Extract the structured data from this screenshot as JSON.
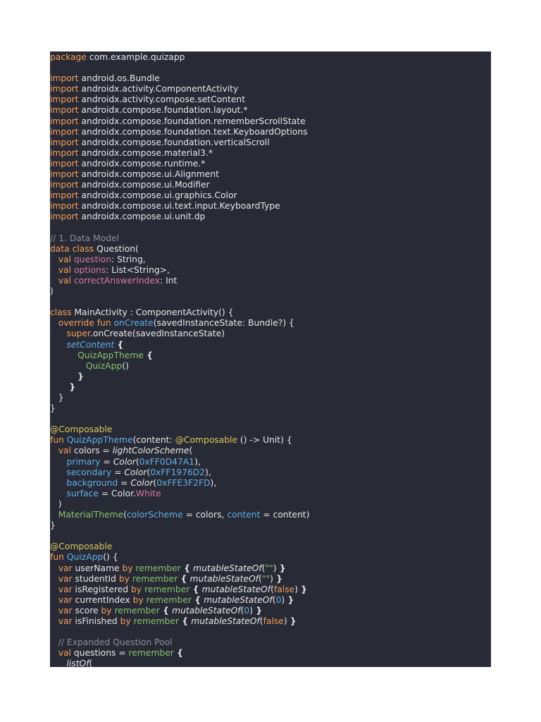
{
  "colors": {
    "page_background": "#ffffff",
    "editor_background": "#282a36",
    "default_text": "#e8e8e8",
    "keyword": "#f5a05a",
    "property": "#d47aa5",
    "function": "#5fb1e8",
    "composable": "#86c46f",
    "annotation": "#d8c95a",
    "comment": "#8b8f9a"
  },
  "code_lines": [
    [
      [
        "keyword",
        "package"
      ],
      [
        "default",
        " com.example.quizapp"
      ]
    ],
    [],
    [
      [
        "keyword",
        "import"
      ],
      [
        "default",
        " android.os.Bundle"
      ]
    ],
    [
      [
        "keyword",
        "import"
      ],
      [
        "default",
        " androidx.activity.ComponentActivity"
      ]
    ],
    [
      [
        "keyword",
        "import"
      ],
      [
        "default",
        " androidx.activity.compose.setContent"
      ]
    ],
    [
      [
        "keyword",
        "import"
      ],
      [
        "default",
        " androidx.compose.foundation.layout.*"
      ]
    ],
    [
      [
        "keyword",
        "import"
      ],
      [
        "default",
        " androidx.compose.foundation.rememberScrollState"
      ]
    ],
    [
      [
        "keyword",
        "import"
      ],
      [
        "default",
        " androidx.compose.foundation.text.KeyboardOptions"
      ]
    ],
    [
      [
        "keyword",
        "import"
      ],
      [
        "default",
        " androidx.compose.foundation.verticalScroll"
      ]
    ],
    [
      [
        "keyword",
        "import"
      ],
      [
        "default",
        " androidx.compose.material3.*"
      ]
    ],
    [
      [
        "keyword",
        "import"
      ],
      [
        "default",
        " androidx.compose.runtime.*"
      ]
    ],
    [
      [
        "keyword",
        "import"
      ],
      [
        "default",
        " androidx.compose.ui.Alignment"
      ]
    ],
    [
      [
        "keyword",
        "import"
      ],
      [
        "default",
        " androidx.compose.ui.Modifier"
      ]
    ],
    [
      [
        "keyword",
        "import"
      ],
      [
        "default",
        " androidx.compose.ui.graphics.Color"
      ]
    ],
    [
      [
        "keyword",
        "import"
      ],
      [
        "default",
        " androidx.compose.ui.text.input.KeyboardType"
      ]
    ],
    [
      [
        "keyword",
        "import"
      ],
      [
        "default",
        " androidx.compose.ui.unit.dp"
      ]
    ],
    [],
    [
      [
        "comment",
        "// 1. Data Model"
      ]
    ],
    [
      [
        "keyword",
        "data class"
      ],
      [
        "default",
        " Question("
      ]
    ],
    [
      [
        "default",
        "   "
      ],
      [
        "keyword",
        "val"
      ],
      [
        "property",
        " question"
      ],
      [
        "default",
        ": String,"
      ]
    ],
    [
      [
        "default",
        "   "
      ],
      [
        "keyword",
        "val"
      ],
      [
        "property",
        " options"
      ],
      [
        "default",
        ": List<String>,"
      ]
    ],
    [
      [
        "default",
        "   "
      ],
      [
        "keyword",
        "val"
      ],
      [
        "property",
        " correctAnswerIndex"
      ],
      [
        "default",
        ": Int"
      ]
    ],
    [
      [
        "default",
        ")"
      ]
    ],
    [],
    [
      [
        "keyword",
        "class"
      ],
      [
        "default",
        " MainActivity : ComponentActivity() {"
      ]
    ],
    [
      [
        "default",
        "   "
      ],
      [
        "keyword",
        "override fun"
      ],
      [
        "function",
        " onCreate"
      ],
      [
        "default",
        "(savedInstanceState: Bundle?) {"
      ]
    ],
    [
      [
        "default",
        "      "
      ],
      [
        "keyword",
        "super"
      ],
      [
        "default",
        ".onCreate(savedInstanceState)"
      ]
    ],
    [
      [
        "default",
        "      "
      ],
      [
        "call",
        "setContent"
      ],
      [
        "bold",
        " {"
      ]
    ],
    [
      [
        "default",
        "          "
      ],
      [
        "green",
        "QuizAppTheme"
      ],
      [
        "bold",
        " {"
      ]
    ],
    [
      [
        "default",
        "             "
      ],
      [
        "green",
        "QuizApp"
      ],
      [
        "default",
        "()"
      ]
    ],
    [
      [
        "default",
        "          "
      ],
      [
        "bold",
        "}"
      ]
    ],
    [
      [
        "default",
        "       "
      ],
      [
        "bold",
        "}"
      ]
    ],
    [
      [
        "default",
        "   }"
      ]
    ],
    [
      [
        "default",
        "}"
      ]
    ],
    [],
    [
      [
        "annotation",
        "@Composable"
      ]
    ],
    [
      [
        "keyword",
        "fun"
      ],
      [
        "function",
        " QuizAppTheme"
      ],
      [
        "default",
        "(content: "
      ],
      [
        "annotation",
        "@Composable"
      ],
      [
        "default",
        " () -> Unit) {"
      ]
    ],
    [
      [
        "default",
        "   "
      ],
      [
        "keyword",
        "val"
      ],
      [
        "default",
        " colors = "
      ],
      [
        "italic",
        "lightColorScheme"
      ],
      [
        "default",
        "("
      ]
    ],
    [
      [
        "default",
        "      "
      ],
      [
        "named-arg",
        "primary"
      ],
      [
        "default",
        " = "
      ],
      [
        "italic",
        "Color"
      ],
      [
        "default",
        "("
      ],
      [
        "number",
        "0xFF0D47A1"
      ],
      [
        "default",
        "),"
      ]
    ],
    [
      [
        "default",
        "      "
      ],
      [
        "named-arg",
        "secondary"
      ],
      [
        "default",
        " = "
      ],
      [
        "italic",
        "Color"
      ],
      [
        "default",
        "("
      ],
      [
        "number",
        "0xFF1976D2"
      ],
      [
        "default",
        "),"
      ]
    ],
    [
      [
        "default",
        "      "
      ],
      [
        "named-arg",
        "background"
      ],
      [
        "default",
        " = "
      ],
      [
        "italic",
        "Color"
      ],
      [
        "default",
        "("
      ],
      [
        "number",
        "0xFFE3F2FD"
      ],
      [
        "default",
        "),"
      ]
    ],
    [
      [
        "default",
        "      "
      ],
      [
        "named-arg",
        "surface"
      ],
      [
        "default",
        " = Color."
      ],
      [
        "property",
        "White"
      ]
    ],
    [
      [
        "default",
        "   )"
      ]
    ],
    [
      [
        "default",
        "   "
      ],
      [
        "green",
        "MaterialTheme"
      ],
      [
        "default",
        "("
      ],
      [
        "named-arg",
        "colorScheme"
      ],
      [
        "default",
        " = colors, "
      ],
      [
        "named-arg",
        "content"
      ],
      [
        "default",
        " = content)"
      ]
    ],
    [
      [
        "default",
        "}"
      ]
    ],
    [],
    [
      [
        "annotation",
        "@Composable"
      ]
    ],
    [
      [
        "keyword",
        "fun"
      ],
      [
        "function",
        " QuizApp"
      ],
      [
        "default",
        "() {"
      ]
    ],
    [
      [
        "default",
        "   "
      ],
      [
        "keyword",
        "var"
      ],
      [
        "default",
        " userName "
      ],
      [
        "keyword",
        "by"
      ],
      [
        "green",
        " remember"
      ],
      [
        "bold",
        " { "
      ],
      [
        "italic",
        "mutableStateOf"
      ],
      [
        "default",
        "("
      ],
      [
        "string",
        "\"\""
      ],
      [
        "default",
        ")"
      ],
      [
        "bold",
        " }"
      ]
    ],
    [
      [
        "default",
        "   "
      ],
      [
        "keyword",
        "var"
      ],
      [
        "default",
        " studentId "
      ],
      [
        "keyword",
        "by"
      ],
      [
        "green",
        " remember"
      ],
      [
        "bold",
        " { "
      ],
      [
        "italic",
        "mutableStateOf"
      ],
      [
        "default",
        "("
      ],
      [
        "string",
        "\"\""
      ],
      [
        "default",
        ")"
      ],
      [
        "bold",
        " }"
      ]
    ],
    [
      [
        "default",
        "   "
      ],
      [
        "keyword",
        "var"
      ],
      [
        "default",
        " isRegistered "
      ],
      [
        "keyword",
        "by"
      ],
      [
        "green",
        " remember"
      ],
      [
        "bold",
        " { "
      ],
      [
        "italic",
        "mutableStateOf"
      ],
      [
        "default",
        "("
      ],
      [
        "keyword",
        "false"
      ],
      [
        "default",
        ")"
      ],
      [
        "bold",
        " }"
      ]
    ],
    [
      [
        "default",
        "   "
      ],
      [
        "keyword",
        "var"
      ],
      [
        "default",
        " currentIndex "
      ],
      [
        "keyword",
        "by"
      ],
      [
        "green",
        " remember"
      ],
      [
        "bold",
        " { "
      ],
      [
        "italic",
        "mutableStateOf"
      ],
      [
        "default",
        "("
      ],
      [
        "number",
        "0"
      ],
      [
        "default",
        ")"
      ],
      [
        "bold",
        " }"
      ]
    ],
    [
      [
        "default",
        "   "
      ],
      [
        "keyword",
        "var"
      ],
      [
        "default",
        " score "
      ],
      [
        "keyword",
        "by"
      ],
      [
        "green",
        " remember"
      ],
      [
        "bold",
        " { "
      ],
      [
        "italic",
        "mutableStateOf"
      ],
      [
        "default",
        "("
      ],
      [
        "number",
        "0"
      ],
      [
        "default",
        ")"
      ],
      [
        "bold",
        " }"
      ]
    ],
    [
      [
        "default",
        "   "
      ],
      [
        "keyword",
        "var"
      ],
      [
        "default",
        " isFinished "
      ],
      [
        "keyword",
        "by"
      ],
      [
        "green",
        " remember"
      ],
      [
        "bold",
        " { "
      ],
      [
        "italic",
        "mutableStateOf"
      ],
      [
        "default",
        "("
      ],
      [
        "keyword",
        "false"
      ],
      [
        "default",
        ")"
      ],
      [
        "bold",
        " }"
      ]
    ],
    [],
    [
      [
        "default",
        "   "
      ],
      [
        "comment",
        "// Expanded Question Pool"
      ]
    ],
    [
      [
        "default",
        "   "
      ],
      [
        "keyword",
        "val"
      ],
      [
        "default",
        " questions = "
      ],
      [
        "green",
        "remember"
      ],
      [
        "bold",
        " {"
      ]
    ],
    [
      [
        "default",
        "      "
      ],
      [
        "italic",
        "listOf"
      ],
      [
        "default",
        "("
      ]
    ]
  ]
}
